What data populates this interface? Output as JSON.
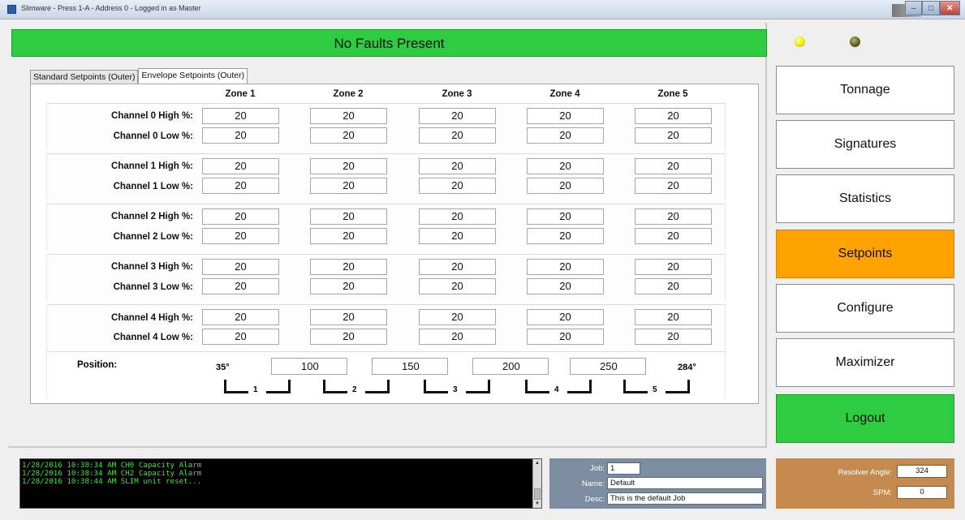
{
  "window": {
    "title": "Slimware - Press 1-A - Address 0 - Logged in as Master"
  },
  "status": {
    "fault_text": "No Faults Present",
    "colors": {
      "fault_ok": "#2ecc40",
      "lamp1": "#eaea00",
      "lamp2": "#5c5c1a"
    }
  },
  "tabs": [
    {
      "label": "Standard Setpoints (Outer)"
    },
    {
      "label": "Envelope Setpoints (Outer)",
      "active": true
    }
  ],
  "zones": [
    "Zone 1",
    "Zone 2",
    "Zone 3",
    "Zone 4",
    "Zone 5"
  ],
  "channels": [
    {
      "high_label": "Channel 0 High %:",
      "low_label": "Channel 0 Low %:",
      "high": [
        "20",
        "20",
        "20",
        "20",
        "20"
      ],
      "low": [
        "20",
        "20",
        "20",
        "20",
        "20"
      ]
    },
    {
      "high_label": "Channel 1 High %:",
      "low_label": "Channel 1 Low %:",
      "high": [
        "20",
        "20",
        "20",
        "20",
        "20"
      ],
      "low": [
        "20",
        "20",
        "20",
        "20",
        "20"
      ]
    },
    {
      "high_label": "Channel 2 High %:",
      "low_label": "Channel 2 Low %:",
      "high": [
        "20",
        "20",
        "20",
        "20",
        "20"
      ],
      "low": [
        "20",
        "20",
        "20",
        "20",
        "20"
      ]
    },
    {
      "high_label": "Channel 3 High %:",
      "low_label": "Channel 3 Low %:",
      "high": [
        "20",
        "20",
        "20",
        "20",
        "20"
      ],
      "low": [
        "20",
        "20",
        "20",
        "20",
        "20"
      ]
    },
    {
      "high_label": "Channel 4 High %:",
      "low_label": "Channel 4 Low %:",
      "high": [
        "20",
        "20",
        "20",
        "20",
        "20"
      ],
      "low": [
        "20",
        "20",
        "20",
        "20",
        "20"
      ]
    }
  ],
  "position": {
    "label": "Position:",
    "start": "35°",
    "end": "284°",
    "boundaries": [
      "100",
      "150",
      "200",
      "250"
    ],
    "zone_numbers": [
      "1",
      "2",
      "3",
      "4",
      "5"
    ]
  },
  "nav": {
    "tonnage": "Tonnage",
    "signatures": "Signatures",
    "statistics": "Statistics",
    "setpoints": "Setpoints",
    "configure": "Configure",
    "maximizer": "Maximizer",
    "logout": "Logout"
  },
  "log": {
    "lines": [
      "1/28/2016 10:38:34 AM  CH0 Capacity Alarm",
      "1/28/2016 10:38:34 AM  CH2 Capacity Alarm",
      "1/28/2016 10:38:44 AM  SLIM unit reset..."
    ]
  },
  "job": {
    "job_label": "Job:",
    "job_value": "1",
    "name_label": "Name:",
    "name_value": "Default",
    "desc_label": "Desc:",
    "desc_value": "This is the default Job"
  },
  "resolver": {
    "angle_label": "Resolver Angle:",
    "angle_value": "324",
    "spm_label": "SPM:",
    "spm_value": "0"
  }
}
